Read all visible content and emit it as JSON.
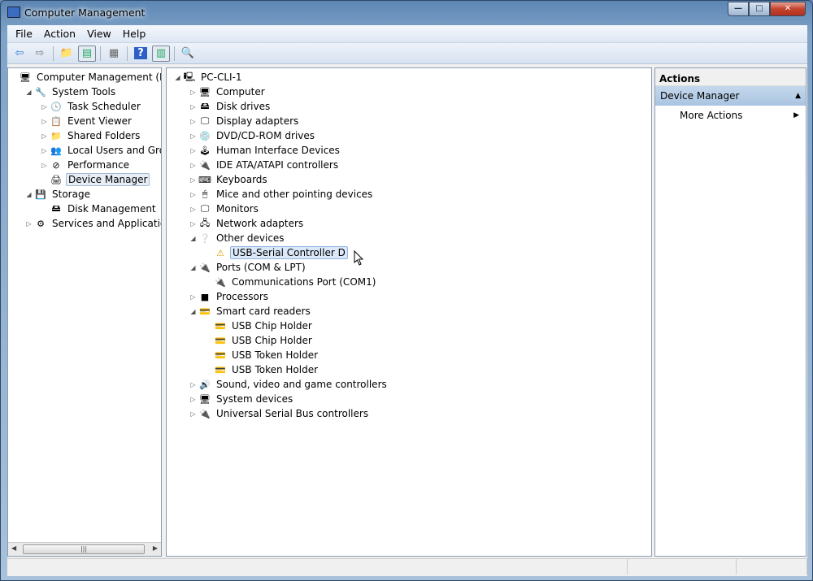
{
  "window": {
    "title": "Computer Management",
    "min": "—",
    "max": "□",
    "close": "✕"
  },
  "menu": [
    "File",
    "Action",
    "View",
    "Help"
  ],
  "toolbar": [
    {
      "icon": "back-arrow-icon",
      "g": "⇦",
      "c": "#2a7fd4"
    },
    {
      "icon": "forward-arrow-icon",
      "g": "⇨",
      "c": "#777"
    },
    {
      "sep": true
    },
    {
      "icon": "up-folder-icon",
      "g": "📁",
      "c": "#d9a72b"
    },
    {
      "icon": "show-hide-console-tree-icon",
      "g": "▤",
      "c": "#2a6",
      "p": true
    },
    {
      "sep": true
    },
    {
      "icon": "export-list-icon",
      "g": "▦",
      "c": "#666"
    },
    {
      "sep": true
    },
    {
      "icon": "help-icon",
      "g": "?",
      "c": "#fff",
      "bg": "#2e5fc4"
    },
    {
      "icon": "show-hide-action-pane-icon",
      "g": "▥",
      "c": "#2a6",
      "p": true
    },
    {
      "sep": true
    },
    {
      "icon": "scan-hardware-icon",
      "g": "🔍",
      "c": "#357"
    }
  ],
  "left_tree": [
    {
      "label": "Computer Management (Local",
      "level": 0,
      "exp": "",
      "icon": "🖥"
    },
    {
      "label": "System Tools",
      "level": 1,
      "exp": "◢",
      "icon": "🔧"
    },
    {
      "label": "Task Scheduler",
      "level": 2,
      "exp": "▷",
      "icon": "🕓"
    },
    {
      "label": "Event Viewer",
      "level": 2,
      "exp": "▷",
      "icon": "📋"
    },
    {
      "label": "Shared Folders",
      "level": 2,
      "exp": "▷",
      "icon": "📁"
    },
    {
      "label": "Local Users and Groups",
      "level": 2,
      "exp": "▷",
      "icon": "👥"
    },
    {
      "label": "Performance",
      "level": 2,
      "exp": "▷",
      "icon": "⊘"
    },
    {
      "label": "Device Manager",
      "level": 2,
      "exp": "",
      "icon": "🖨",
      "selected": true
    },
    {
      "label": "Storage",
      "level": 1,
      "exp": "◢",
      "icon": "💾"
    },
    {
      "label": "Disk Management",
      "level": 2,
      "exp": "",
      "icon": "🖴"
    },
    {
      "label": "Services and Applications",
      "level": 1,
      "exp": "▷",
      "icon": "⚙"
    }
  ],
  "device_tree": [
    {
      "label": "PC-CLI-1",
      "level": 0,
      "exp": "◢",
      "icon": "🖳"
    },
    {
      "label": "Computer",
      "level": 1,
      "exp": "▷",
      "icon": "🖥"
    },
    {
      "label": "Disk drives",
      "level": 1,
      "exp": "▷",
      "icon": "🖴"
    },
    {
      "label": "Display adapters",
      "level": 1,
      "exp": "▷",
      "icon": "🖵"
    },
    {
      "label": "DVD/CD-ROM drives",
      "level": 1,
      "exp": "▷",
      "icon": "💿"
    },
    {
      "label": "Human Interface Devices",
      "level": 1,
      "exp": "▷",
      "icon": "🕹"
    },
    {
      "label": "IDE ATA/ATAPI controllers",
      "level": 1,
      "exp": "▷",
      "icon": "🔌"
    },
    {
      "label": "Keyboards",
      "level": 1,
      "exp": "▷",
      "icon": "⌨"
    },
    {
      "label": "Mice and other pointing devices",
      "level": 1,
      "exp": "▷",
      "icon": "🖱"
    },
    {
      "label": "Monitors",
      "level": 1,
      "exp": "▷",
      "icon": "🖵"
    },
    {
      "label": "Network adapters",
      "level": 1,
      "exp": "▷",
      "icon": "🖧"
    },
    {
      "label": "Other devices",
      "level": 1,
      "exp": "◢",
      "icon": "❔"
    },
    {
      "label": "USB-Serial Controller D",
      "level": 2,
      "exp": "",
      "icon": "⚠",
      "selected": true
    },
    {
      "label": "Ports (COM & LPT)",
      "level": 1,
      "exp": "◢",
      "icon": "🔌"
    },
    {
      "label": "Communications Port (COM1)",
      "level": 2,
      "exp": "",
      "icon": "🔌"
    },
    {
      "label": "Processors",
      "level": 1,
      "exp": "▷",
      "icon": "■"
    },
    {
      "label": "Smart card readers",
      "level": 1,
      "exp": "◢",
      "icon": "💳"
    },
    {
      "label": "USB Chip Holder",
      "level": 2,
      "exp": "",
      "icon": "💳"
    },
    {
      "label": "USB Chip Holder",
      "level": 2,
      "exp": "",
      "icon": "💳"
    },
    {
      "label": "USB Token Holder",
      "level": 2,
      "exp": "",
      "icon": "💳"
    },
    {
      "label": "USB Token Holder",
      "level": 2,
      "exp": "",
      "icon": "💳"
    },
    {
      "label": "Sound, video and game controllers",
      "level": 1,
      "exp": "▷",
      "icon": "🔊"
    },
    {
      "label": "System devices",
      "level": 1,
      "exp": "▷",
      "icon": "🖥"
    },
    {
      "label": "Universal Serial Bus controllers",
      "level": 1,
      "exp": "▷",
      "icon": "🔌"
    }
  ],
  "actions": {
    "header": "Actions",
    "section": "Device Manager",
    "section_arrow": "▲",
    "item": "More Actions",
    "item_arrow": "▶"
  },
  "scroll": {
    "left": "◀",
    "right": "▶",
    "grip": "|||"
  }
}
